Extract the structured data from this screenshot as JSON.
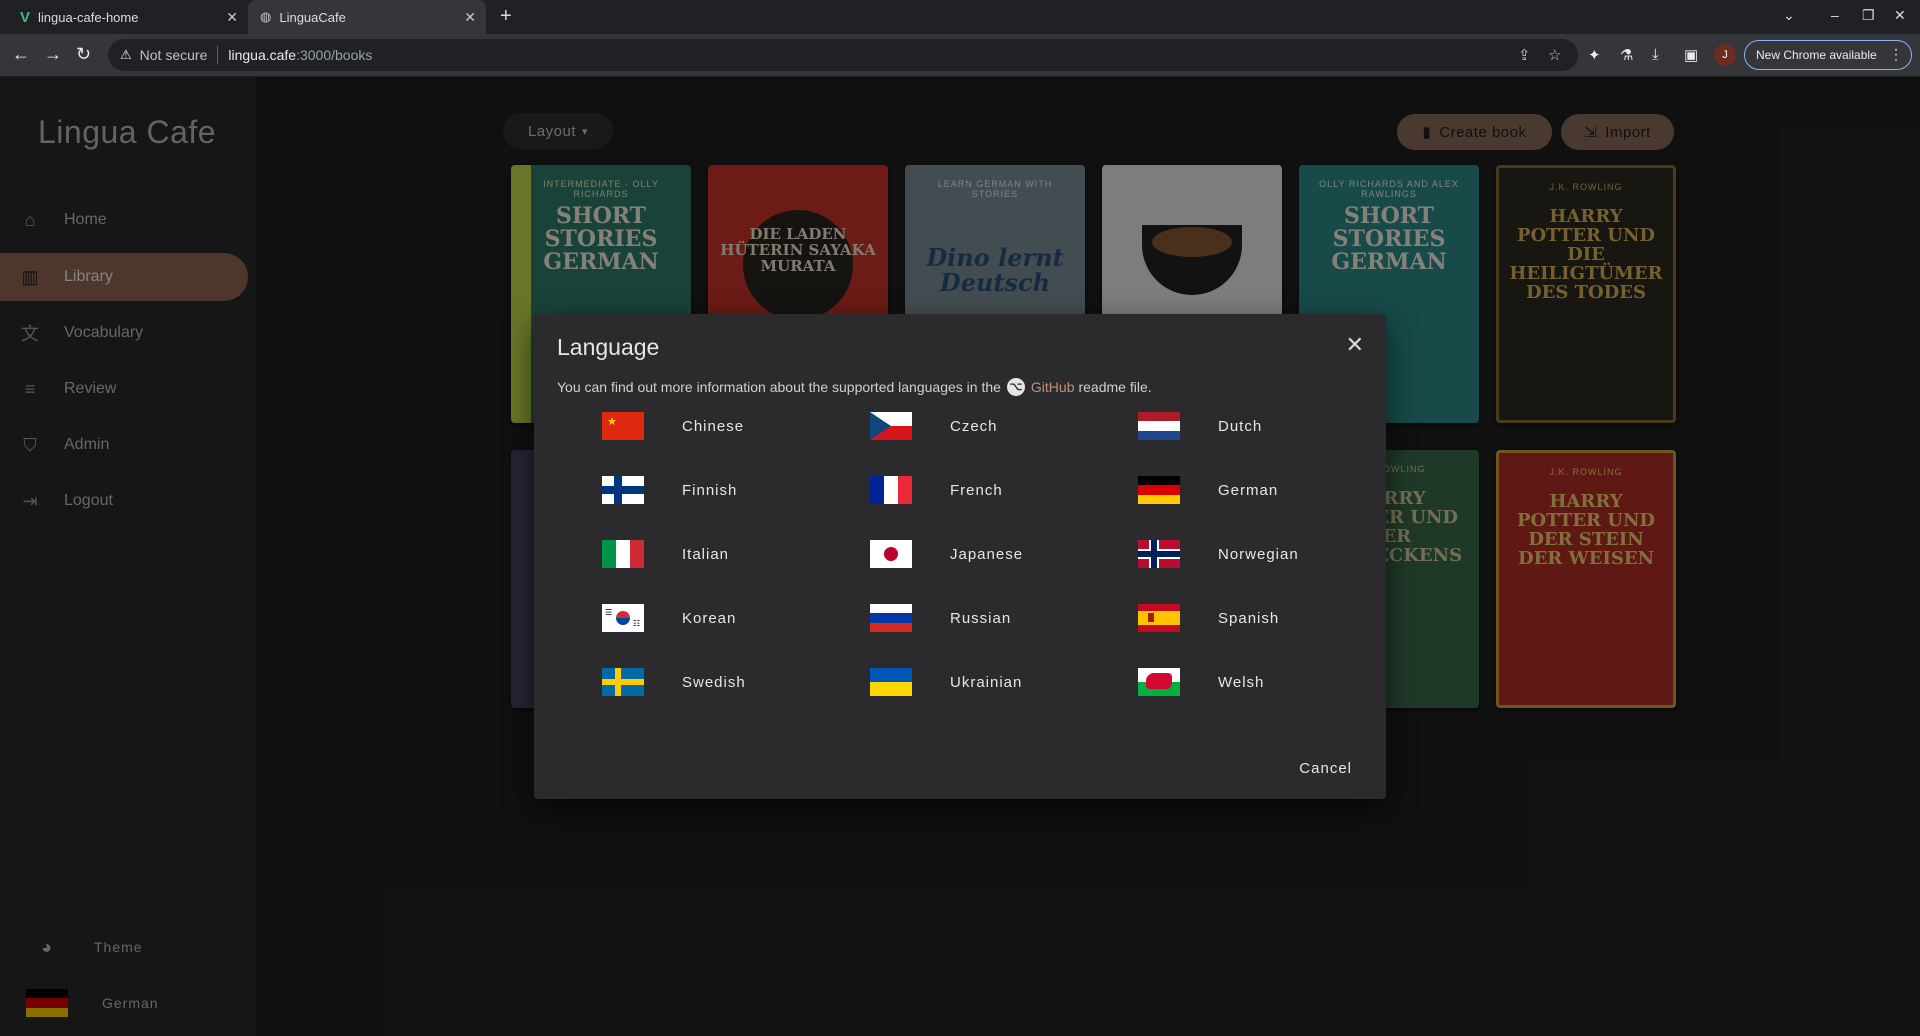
{
  "browser": {
    "tabs": [
      {
        "title": "lingua-cafe-home",
        "icon": "vue-logo-icon"
      },
      {
        "title": "LinguaCafe",
        "icon": "globe-icon"
      }
    ],
    "security": "Not secure",
    "url_host": "lingua.cafe",
    "url_path": ":3000/books",
    "profile_initial": "J",
    "update_label": "New Chrome available"
  },
  "sidebar": {
    "app_title": "Lingua Cafe",
    "items": [
      {
        "label": "Home",
        "icon": "home-icon"
      },
      {
        "label": "Library",
        "icon": "library-icon",
        "active": true
      },
      {
        "label": "Vocabulary",
        "icon": "translate-icon"
      },
      {
        "label": "Review",
        "icon": "review-icon"
      },
      {
        "label": "Admin",
        "icon": "shield-icon"
      },
      {
        "label": "Logout",
        "icon": "logout-icon"
      }
    ],
    "theme_label": "Theme",
    "language_label": "German"
  },
  "library": {
    "layout_label": "Layout",
    "create_label": "Create book",
    "import_label": "Import",
    "books": [
      {
        "subtitle": "INTERMEDIATE · OLLY RICHARDS",
        "title": "SHORT STORIES GERMAN"
      },
      {
        "subtitle": "",
        "title": "DIE LADEN HÜTERIN SAYAKA MURATA"
      },
      {
        "subtitle": "LEARN GERMAN WITH STORIES",
        "title": "Dino lernt Deutsch"
      },
      {
        "subtitle": "",
        "title": ""
      },
      {
        "subtitle": "OLLY RICHARDS AND ALEX RAWLINGS",
        "title": "SHORT STORIES GERMAN"
      },
      {
        "subtitle": "J.K. ROWLING",
        "title": "HARRY POTTER UND DIE HEILIGTÜMER DES TODES"
      },
      {
        "subtitle": "",
        "title": ""
      },
      {
        "subtitle": "J.K. ROWLING",
        "title": "HARRY POTTER UND DER SCHRECKENS"
      },
      {
        "subtitle": "J.K. ROWLING",
        "title": "HARRY POTTER UND DER STEIN DER WEISEN"
      }
    ]
  },
  "dialog": {
    "title": "Language",
    "info_before": "You can find out more information about the supported languages in the",
    "info_link": "GitHub",
    "info_after": "readme file.",
    "languages": [
      "Chinese",
      "Czech",
      "Dutch",
      "Finnish",
      "French",
      "German",
      "Italian",
      "Japanese",
      "Norwegian",
      "Korean",
      "Russian",
      "Spanish",
      "Swedish",
      "Ukrainian",
      "Welsh"
    ],
    "cancel_label": "Cancel"
  },
  "colors": {
    "accent": "#8e6654",
    "link": "#c48f73",
    "background": "#1f1f1f",
    "dialog": "#2b2b2e"
  }
}
